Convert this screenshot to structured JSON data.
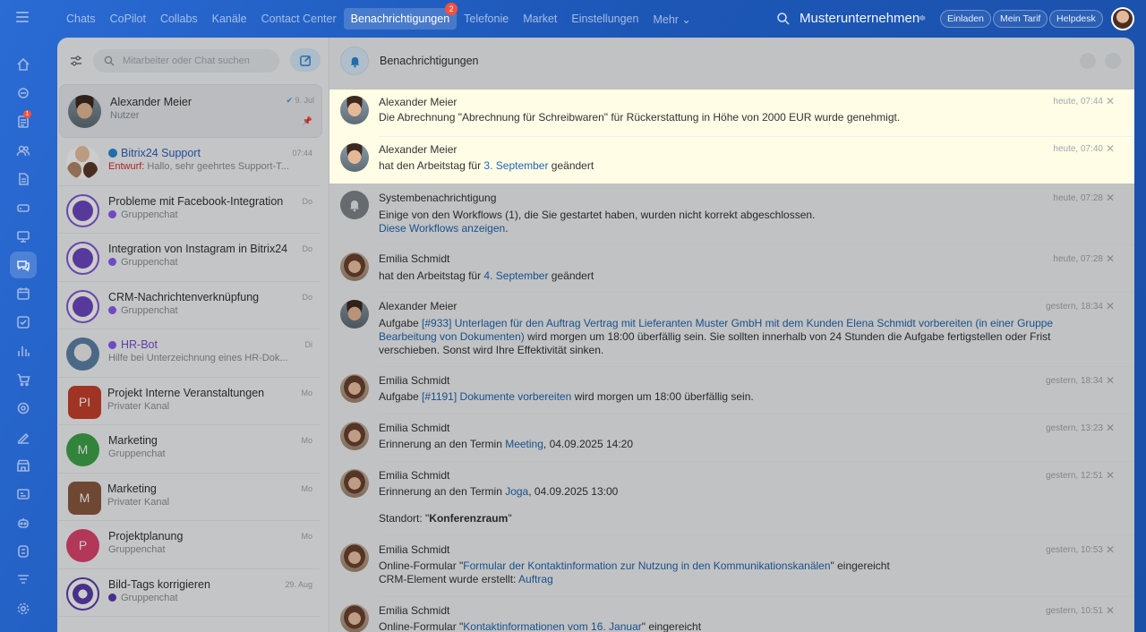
{
  "topnav": {
    "items": [
      "Chats",
      "CoPilot",
      "Collabs",
      "Kanäle",
      "Contact Center",
      "Benachrichtigungen",
      "Telefonie",
      "Market",
      "Einstellungen",
      "Mehr ⌄"
    ],
    "active_badge": "2",
    "company": "Musterunternehmen",
    "buttons": [
      "Einladen",
      "Mein Tarif",
      "Helpdesk"
    ]
  },
  "rail": {
    "feed_badge": "1"
  },
  "chatlist": {
    "search_placeholder": "Mitarbeiter oder Chat suchen",
    "items": [
      {
        "name": "Alexander Meier",
        "sub": "Nutzer",
        "date": "9. Jul"
      },
      {
        "name": "Bitrix24 Support",
        "draft": "Entwurf:",
        "sub": " Hallo, sehr geehrtes Support-T...",
        "date": "07:44"
      },
      {
        "name": "Probleme mit Facebook-Integration",
        "sub": "Gruppenchat",
        "date": "Do"
      },
      {
        "name": "Integration von Instagram in Bitrix24",
        "sub": "Gruppenchat",
        "date": "Do"
      },
      {
        "name": "CRM-Nachrichtenverknüpfung",
        "sub": "Gruppenchat",
        "date": "Do"
      },
      {
        "name": "HR-Bot",
        "sub": "Hilfe bei Unterzeichnung eines HR-Dok...",
        "date": "Di"
      },
      {
        "name": "Projekt Interne Veranstaltungen",
        "sub": "Privater Kanal",
        "date": "Mo",
        "initials": "PI",
        "color": "#c8412d"
      },
      {
        "name": "Marketing",
        "sub": "Gruppenchat",
        "date": "Mo",
        "initials": "M",
        "color": "#3fa54a"
      },
      {
        "name": "Marketing",
        "sub": "Privater Kanal",
        "date": "Mo",
        "initials": "M",
        "color": "#8b5a42"
      },
      {
        "name": "Projektplanung",
        "sub": "Gruppenchat",
        "date": "Mo",
        "initials": "P",
        "color": "#e0456e"
      },
      {
        "name": "Bild-Tags korrigieren",
        "sub": "Gruppenchat",
        "date": "29. Aug"
      }
    ]
  },
  "notifications": {
    "title": "Benachrichtigungen",
    "items": [
      {
        "name": "Alexander Meier",
        "time": "heute, 07:44",
        "l1": "Die Abrechnung \"Abrechnung für Schreibwaren\" für Rückerstattung in Höhe von 2000 EUR wurde genehmigt."
      },
      {
        "name": "Alexander Meier",
        "time": "heute, 07:40",
        "l1a": "hat den Arbeitstag für ",
        "l1link": "3. September",
        "l1b": " geändert"
      },
      {
        "name": "Systembenachrichtigung",
        "time": "heute, 07:28",
        "l1": "Einige von den Workflows (1), die Sie gestartet haben, wurden nicht korrekt abgeschlossen.",
        "l2link": "Diese Workflows anzeigen",
        "l2b": "."
      },
      {
        "name": "Emilia Schmidt",
        "time": "heute, 07:28",
        "l1a": "hat den Arbeitstag für ",
        "l1link": "4. September",
        "l1b": " geändert"
      },
      {
        "name": "Alexander Meier",
        "time": "gestern, 18:34",
        "l1a": "Aufgabe ",
        "l1link": "[#933] Unterlagen für den Auftrag Vertrag mit Lieferanten Muster GmbH mit dem Kunden Elena Schmidt vorbereiten (in einer Gruppe",
        "l2link": "Bearbeitung von Dokumenten)",
        "l2b": " wird morgen um 18:00 überfällig sein. Sie sollten innerhalb von 24 Stunden die Aufgabe fertigstellen oder Frist",
        "l3": "verschieben. Sonst wird Ihre Effektivität sinken."
      },
      {
        "name": "Emilia Schmidt",
        "time": "gestern, 18:34",
        "l1a": "Aufgabe ",
        "l1link": "[#1191] Dokumente vorbereiten",
        "l1b": " wird morgen um 18:00 überfällig sein."
      },
      {
        "name": "Emilia Schmidt",
        "time": "gestern, 13:23",
        "l1a": "Erinnerung an den Termin ",
        "l1link": "Meeting",
        "l1b": ", 04.09.2025 14:20"
      },
      {
        "name": "Emilia Schmidt",
        "time": "gestern, 12:51",
        "l1a": "Erinnerung an den Termin ",
        "l1link": "Joga",
        "l1b": ", 04.09.2025 13:00",
        "l3a": "Standort: \"",
        "l3bold": "Konferenzraum",
        "l3b": "\""
      },
      {
        "name": "Emilia Schmidt",
        "time": "gestern, 10:53",
        "l1a": "Online-Formular \"",
        "l1link": "Formular der Kontaktinformation zur Nutzung in den Kommunikationskanälen",
        "l1b": "\" eingereicht",
        "l2a": "CRM-Element wurde erstellt: ",
        "l2link": "Auftrag"
      },
      {
        "name": "Emilia Schmidt",
        "time": "gestern, 10:51",
        "l1a": "Online-Formular \"",
        "l1link": "Kontaktinformationen vom 16. Januar",
        "l1b": "\" eingereicht"
      }
    ]
  }
}
